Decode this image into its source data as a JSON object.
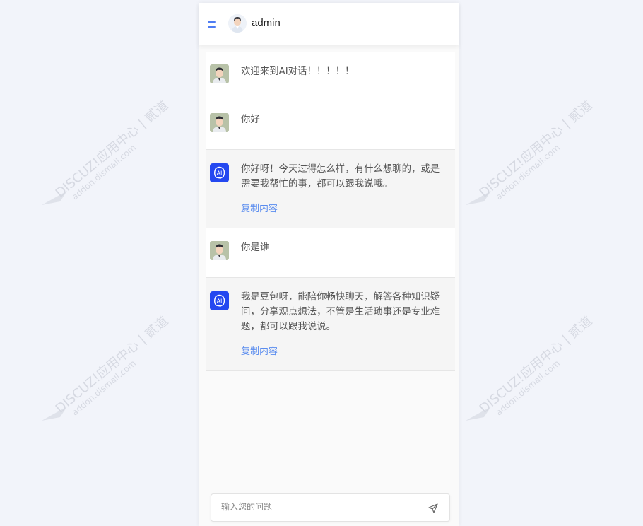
{
  "watermark": {
    "line1": "DISCUZ!应用中心 | 贰道",
    "line2": "addon.dismall.com",
    "mark": "®"
  },
  "header": {
    "username": "admin"
  },
  "messages": [
    {
      "role": "user",
      "text": "欢迎来到AI对话！！！！！"
    },
    {
      "role": "user",
      "text": "你好"
    },
    {
      "role": "ai",
      "text": "你好呀！今天过得怎么样，有什么想聊的，或是需要我帮忙的事，都可以跟我说哦。",
      "copy_label": "复制内容"
    },
    {
      "role": "user",
      "text": "你是谁"
    },
    {
      "role": "ai",
      "text": "我是豆包呀，能陪你畅快聊天，解答各种知识疑问，分享观点想法，不管是生活琐事还是专业难题，都可以跟我说说。",
      "copy_label": "复制内容"
    }
  ],
  "input": {
    "placeholder": "输入您的问题"
  },
  "colors": {
    "accent": "#5b8def",
    "ai_avatar": "#2448f0"
  }
}
